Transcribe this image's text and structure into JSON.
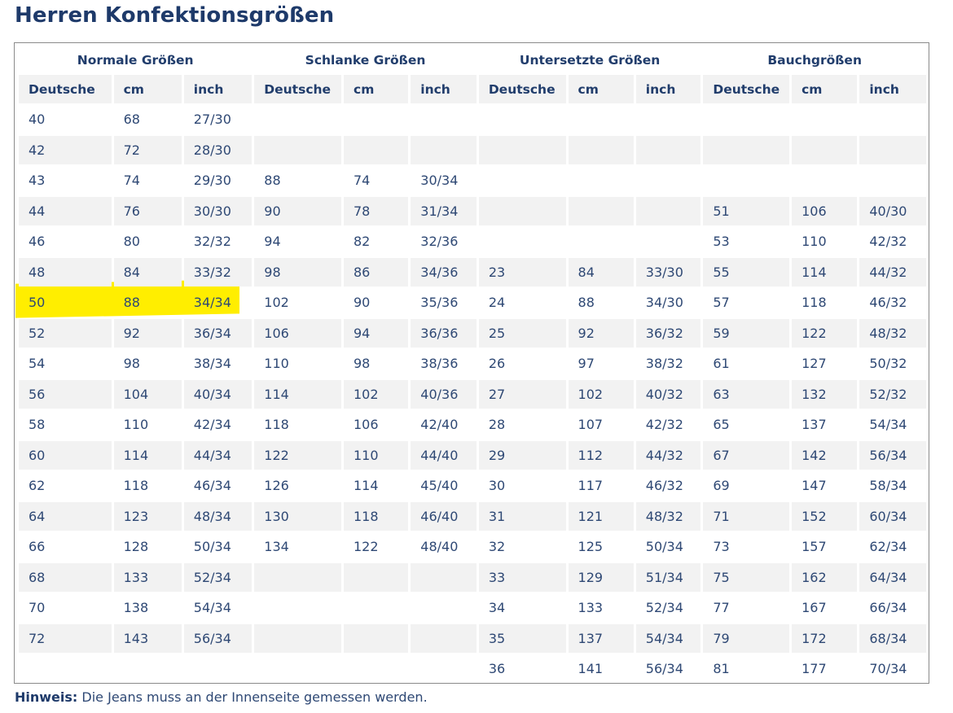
{
  "page": {
    "title": "Herren Konfektionsgrößen",
    "note_label": "Hinweis:",
    "note_text": "Die Jeans muss an der Innenseite gemessen werden."
  },
  "highlight_color": "#ffee00",
  "table": {
    "groups": [
      "Normale Größen",
      "Schlanke Größen",
      "Untersetzte Größen",
      "Bauchgrößen"
    ],
    "subheaders": [
      "Deutsche",
      "cm",
      "inch",
      "Deutsche",
      "cm",
      "inch",
      "Deutsche",
      "cm",
      "inch",
      "Deutsche",
      "cm",
      "inch"
    ],
    "rows": [
      [
        "40",
        "68",
        "27/30",
        "",
        "",
        "",
        "",
        "",
        "",
        "",
        "",
        ""
      ],
      [
        "42",
        "72",
        "28/30",
        "",
        "",
        "",
        "",
        "",
        "",
        "",
        "",
        ""
      ],
      [
        "43",
        "74",
        "29/30",
        "88",
        "74",
        "30/34",
        "",
        "",
        "",
        "",
        "",
        ""
      ],
      [
        "44",
        "76",
        "30/30",
        "90",
        "78",
        "31/34",
        "",
        "",
        "",
        "51",
        "106",
        "40/30"
      ],
      [
        "46",
        "80",
        "32/32",
        "94",
        "82",
        "32/36",
        "",
        "",
        "",
        "53",
        "110",
        "42/32"
      ],
      [
        "48",
        "84",
        "33/32",
        "98",
        "86",
        "34/36",
        "23",
        "84",
        "33/30",
        "55",
        "114",
        "44/32"
      ],
      [
        "50",
        "88",
        "34/34",
        "102",
        "90",
        "35/36",
        "24",
        "88",
        "34/30",
        "57",
        "118",
        "46/32"
      ],
      [
        "52",
        "92",
        "36/34",
        "106",
        "94",
        "36/36",
        "25",
        "92",
        "36/32",
        "59",
        "122",
        "48/32"
      ],
      [
        "54",
        "98",
        "38/34",
        "110",
        "98",
        "38/36",
        "26",
        "97",
        "38/32",
        "61",
        "127",
        "50/32"
      ],
      [
        "56",
        "104",
        "40/34",
        "114",
        "102",
        "40/36",
        "27",
        "102",
        "40/32",
        "63",
        "132",
        "52/32"
      ],
      [
        "58",
        "110",
        "42/34",
        "118",
        "106",
        "42/40",
        "28",
        "107",
        "42/32",
        "65",
        "137",
        "54/34"
      ],
      [
        "60",
        "114",
        "44/34",
        "122",
        "110",
        "44/40",
        "29",
        "112",
        "44/32",
        "67",
        "142",
        "56/34"
      ],
      [
        "62",
        "118",
        "46/34",
        "126",
        "114",
        "45/40",
        "30",
        "117",
        "46/32",
        "69",
        "147",
        "58/34"
      ],
      [
        "64",
        "123",
        "48/34",
        "130",
        "118",
        "46/40",
        "31",
        "121",
        "48/32",
        "71",
        "152",
        "60/34"
      ],
      [
        "66",
        "128",
        "50/34",
        "134",
        "122",
        "48/40",
        "32",
        "125",
        "50/34",
        "73",
        "157",
        "62/34"
      ],
      [
        "68",
        "133",
        "52/34",
        "",
        "",
        "",
        "33",
        "129",
        "51/34",
        "75",
        "162",
        "64/34"
      ],
      [
        "70",
        "138",
        "54/34",
        "",
        "",
        "",
        "34",
        "133",
        "52/34",
        "77",
        "167",
        "66/34"
      ],
      [
        "72",
        "143",
        "56/34",
        "",
        "",
        "",
        "35",
        "137",
        "54/34",
        "79",
        "172",
        "68/34"
      ],
      [
        "",
        "",
        "",
        "",
        "",
        "",
        "36",
        "141",
        "56/34",
        "81",
        "177",
        "70/34"
      ]
    ]
  }
}
